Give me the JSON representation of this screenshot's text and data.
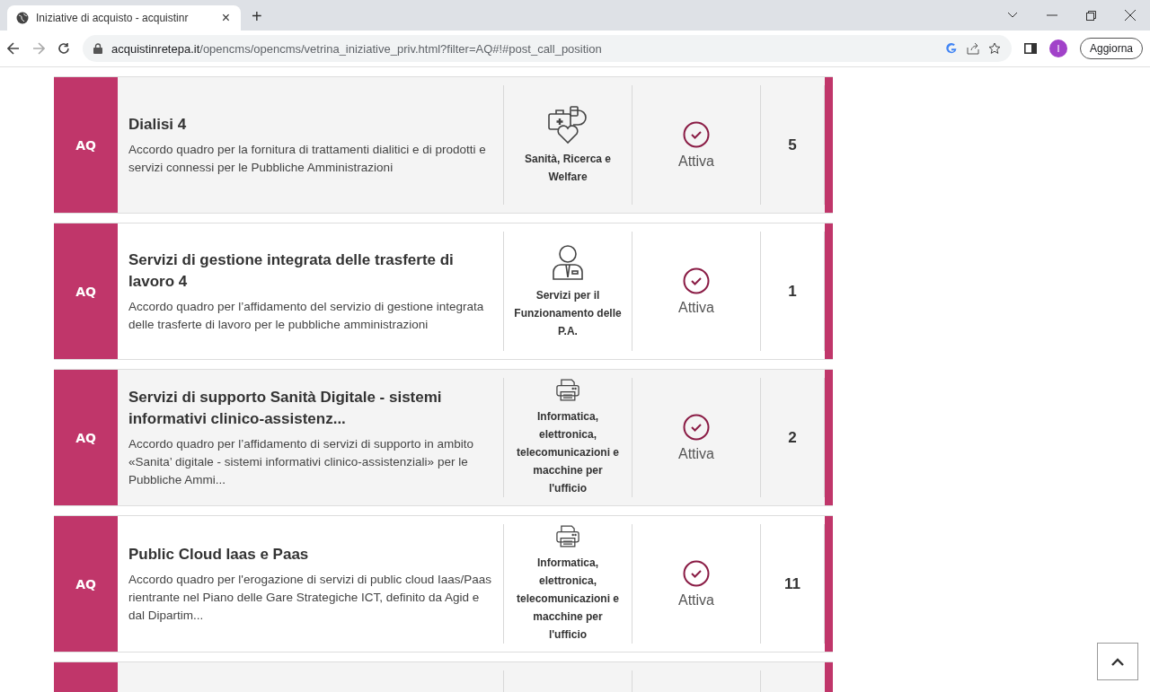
{
  "browser": {
    "tab_title": "Iniziative di acquisto - acquistinr",
    "tab_close": "×",
    "new_tab": "+",
    "url_domain": "acquistinretepa.it",
    "url_path": "/opencms/opencms/vetrina_iniziative_priv.html?filter=AQ#!#post_call_position",
    "profile_initial": "I",
    "update_button": "Aggiorna"
  },
  "initiatives": [
    {
      "badge": "AQ",
      "title": "Dialisi 4",
      "description": "Accordo quadro per la fornitura di trattamenti dialitici e di prodotti e servizi connessi per le Pubbliche Amministrazioni",
      "kind": "health",
      "category": "Sanità, Ricerca e Welfare",
      "status": "Attiva",
      "count": "5"
    },
    {
      "badge": "AQ",
      "title": "Servizi di gestione integrata delle trasferte di lavoro 4",
      "description": "Accordo quadro per l’affidamento del servizio di gestione integrata delle trasferte di lavoro per le pubbliche amministrazioni",
      "kind": "person",
      "category": "Servizi per il Funzionamento delle P.A.",
      "status": "Attiva",
      "count": "1"
    },
    {
      "badge": "AQ",
      "title": "Servizi di supporto Sanità Digitale - sistemi informativi clinico-assistenz...",
      "description": "Accordo quadro per l’affidamento di servizi di supporto in ambito «Sanita’ digitale - sistemi informativi clinico-assistenziali» per le Pubbliche Ammi...",
      "kind": "printer",
      "category": "Informatica, elettronica, telecomunicazioni e macchine per l'ufficio",
      "status": "Attiva",
      "count": "2"
    },
    {
      "badge": "AQ",
      "title": "Public Cloud Iaas e Paas",
      "description": "Accordo quadro per l'erogazione di servizi di public cloud Iaas/Paas rientrante nel Piano delle Gare Strategiche ICT, definito da Agid e dal Dipartim...",
      "kind": "printer",
      "category": "Informatica, elettronica, telecomunicazioni e macchine per l'ufficio",
      "status": "Attiva",
      "count": "11"
    }
  ]
}
